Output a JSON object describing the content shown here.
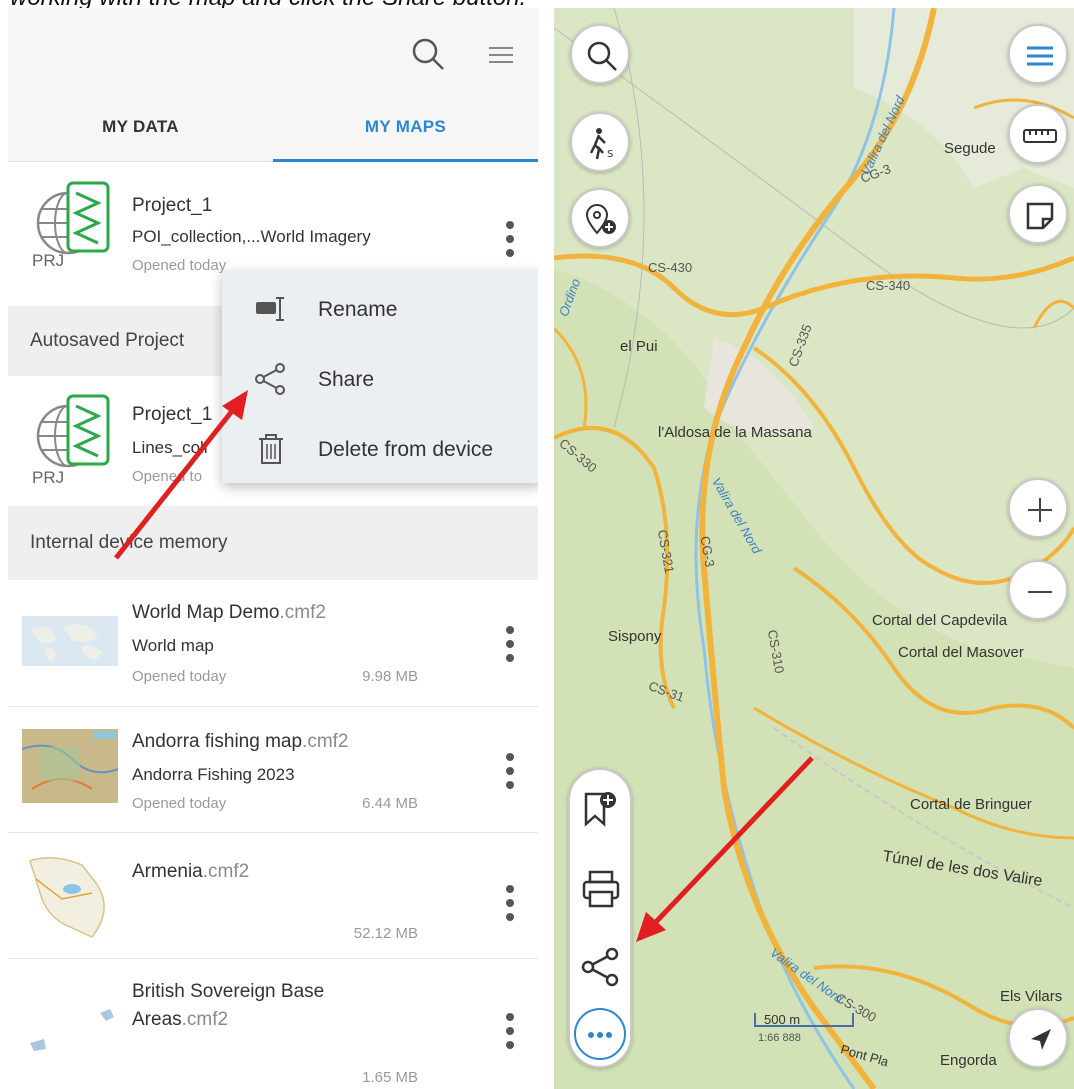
{
  "caption": "working with the map and click the Share button.",
  "left_panel": {
    "tabs": [
      {
        "label": "MY DATA",
        "active": false
      },
      {
        "label": "MY MAPS",
        "active": true
      }
    ],
    "projects": [
      {
        "title": "Project_1",
        "sub": "POI_collection,...World Imagery",
        "meta": "Opened today",
        "badge": "PRJ"
      },
      {
        "title": "Project_1",
        "sub": "Lines_coll",
        "meta": "Opened to",
        "badge": "PRJ"
      }
    ],
    "sections": {
      "autosaved": "Autosaved Project",
      "internal": "Internal device memory"
    },
    "context_menu": [
      {
        "icon": "rename-icon",
        "label": "Rename"
      },
      {
        "icon": "share-icon",
        "label": "Share"
      },
      {
        "icon": "trash-icon",
        "label": "Delete from device"
      }
    ],
    "maps": [
      {
        "name": "World Map Demo",
        "ext": ".cmf2",
        "sub": "World map",
        "meta": "Opened today",
        "size": "9.98 MB"
      },
      {
        "name": "Andorra fishing map",
        "ext": ".cmf2",
        "sub": "Andorra Fishing 2023",
        "meta": "Opened today",
        "size": "6.44 MB"
      },
      {
        "name": "Armenia",
        "ext": ".cmf2",
        "sub": "",
        "meta": "",
        "size": "52.12 MB"
      },
      {
        "name": "British Sovereign Base",
        "name2": "Areas",
        "ext": ".cmf2",
        "sub": "",
        "meta": "",
        "size": "1.65 MB"
      }
    ]
  },
  "map": {
    "place_labels": [
      "Segude",
      "el Pui",
      "l'Aldosa de la Massana",
      "Sispony",
      "Cortal del Capdevila",
      "Cortal del Masover",
      "Cortal de Bringuer",
      "Túnel de les dos Valire",
      "Els Vilars",
      "Engorda"
    ],
    "road_labels": [
      "CG-3",
      "CS-430",
      "CS-340",
      "CS-335",
      "CS-330",
      "CS-321",
      "CS-310",
      "CG-3",
      "CS-300",
      "CS-31"
    ],
    "water_labels": [
      "Valira del Nord",
      "Valira del Nord",
      "Valira del Nord",
      "Ordino"
    ],
    "scale_text": "500 m",
    "scale_ratio": "1:66 888",
    "partial_labels": [
      "Pont Pla"
    ]
  },
  "colors": {
    "accent": "#2d86d2",
    "arrow": "#e02020",
    "map_bg": "#e2ecd0",
    "road_major": "#f2b33d",
    "water": "#8ec3e8"
  }
}
